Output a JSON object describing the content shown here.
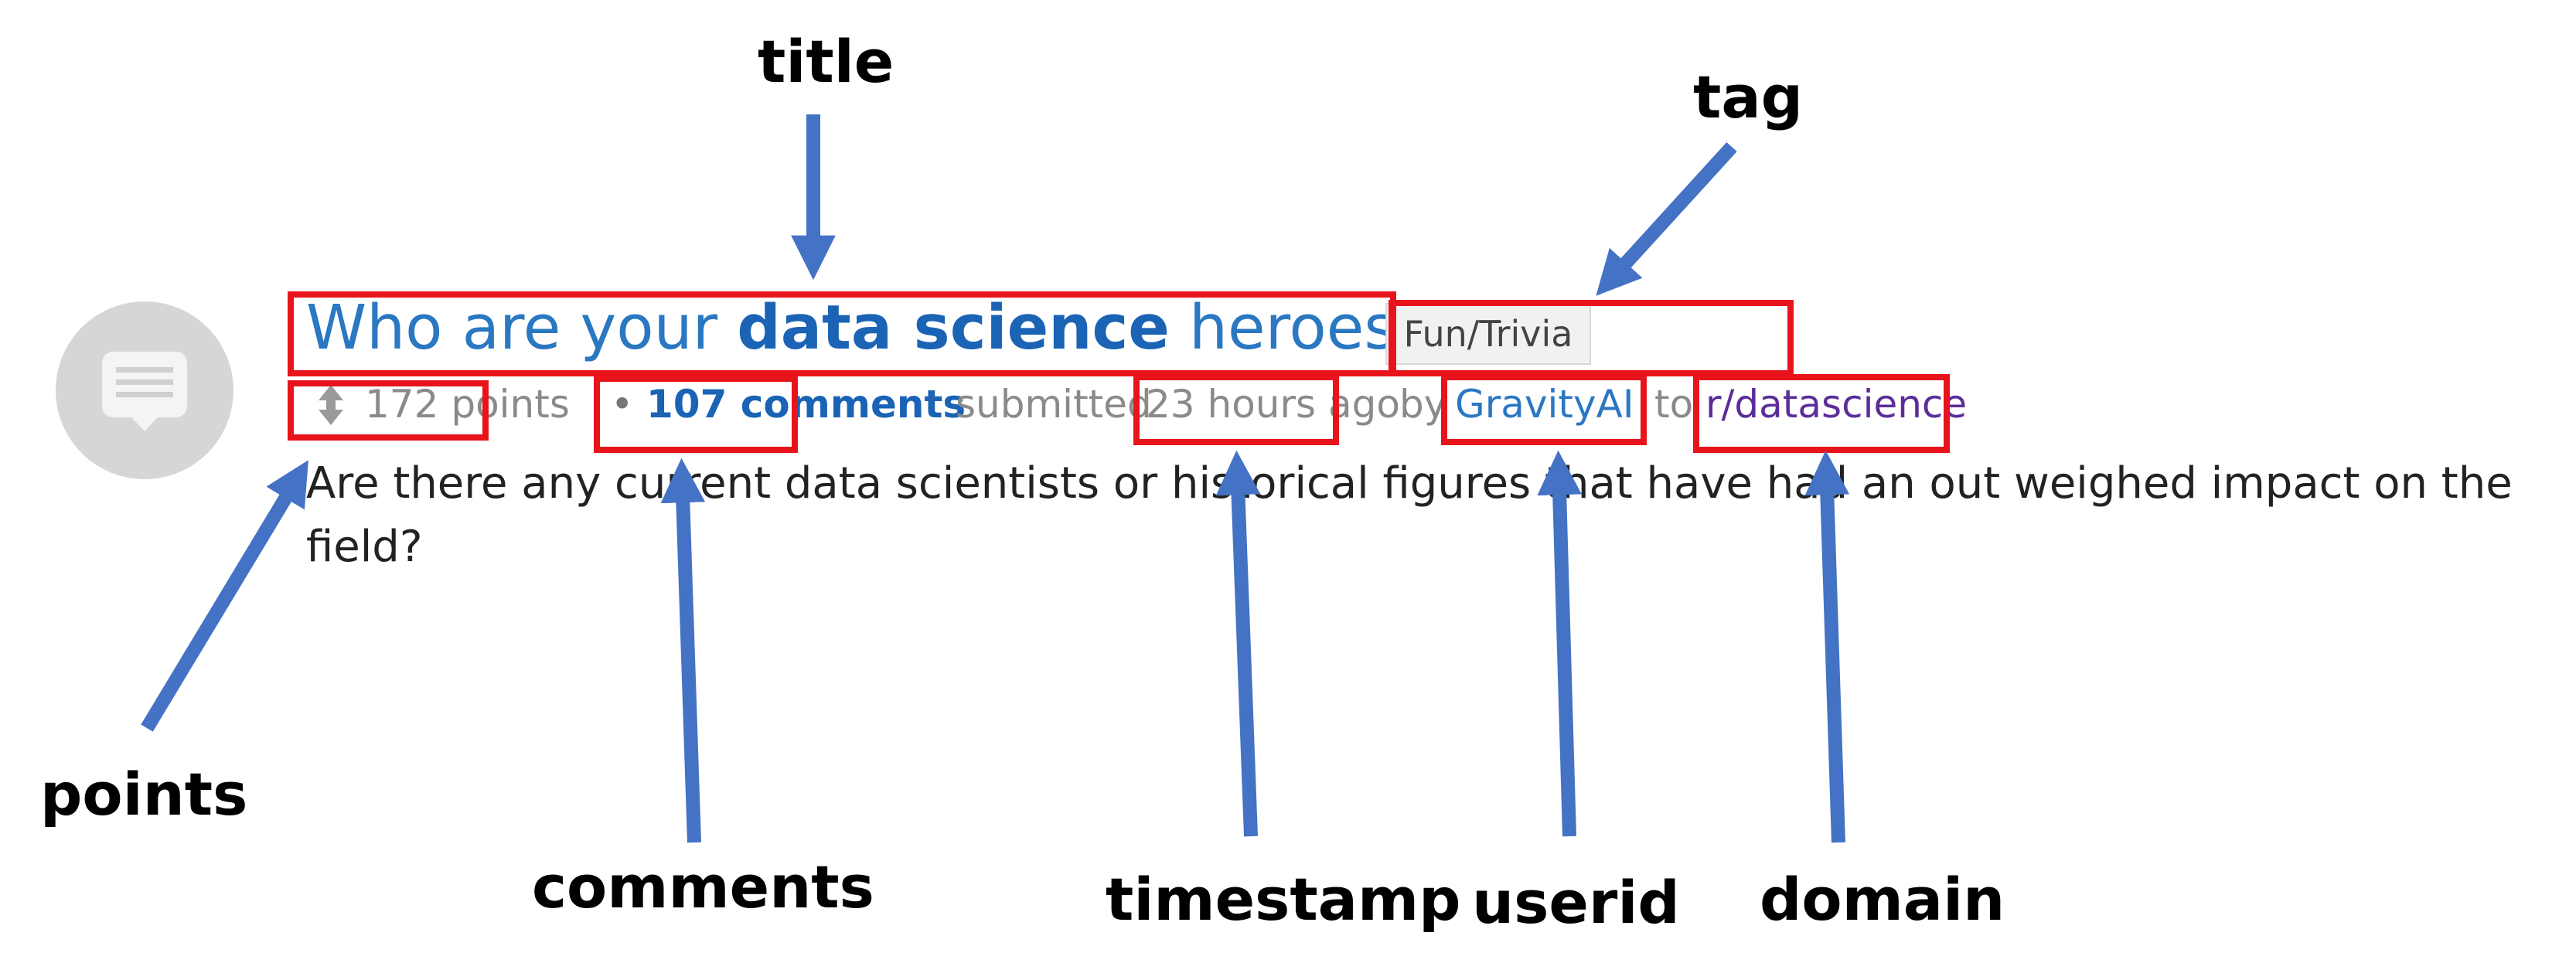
{
  "post": {
    "title_prefix": "Who are your ",
    "title_bold": "data science",
    "title_suffix": " heroes?",
    "tag": "Fun/Trivia",
    "points": "172 points",
    "separator": "•",
    "comments": "107 comments",
    "submitted": "submitted",
    "timestamp": "23 hours ago",
    "by": "by",
    "userid": "GravityAI",
    "to": "to",
    "domain": "r/datascience",
    "body": "Are there any current data scientists or historical figures that have had an out weighed impact on the field?"
  },
  "annotations": {
    "title": "title",
    "tag": "tag",
    "points": "points",
    "comments": "comments",
    "timestamp": "timestamp",
    "userid": "userid",
    "domain": "domain"
  },
  "colors": {
    "link": "#2a77c2",
    "meta_gray": "#8a8a8a",
    "domain": "#5b2d9a",
    "box": "#e8141c",
    "arrow": "#4472c4"
  }
}
